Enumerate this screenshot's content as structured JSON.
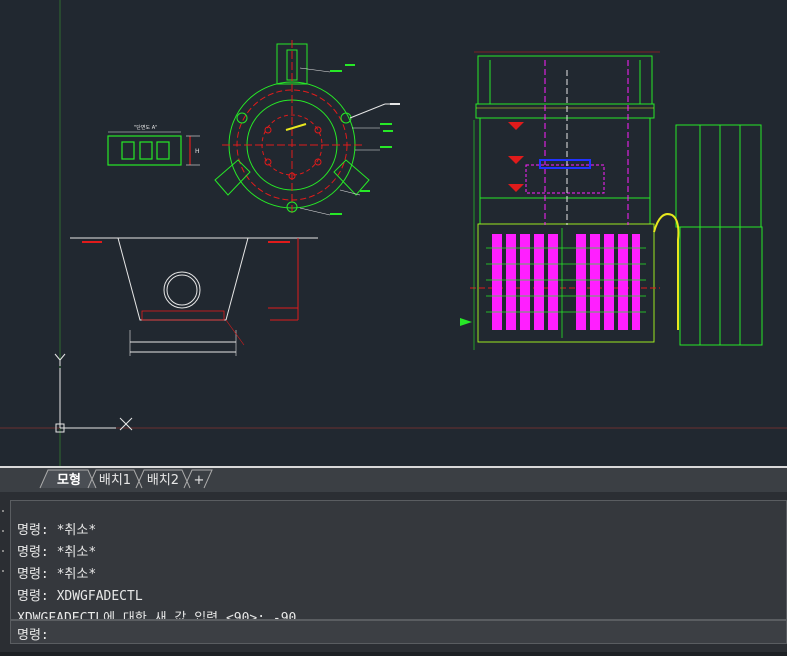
{
  "layout_tabs": [
    {
      "label": "모형",
      "active": true
    },
    {
      "label": "배치1",
      "active": false
    },
    {
      "label": "배치2",
      "active": false
    },
    {
      "label": "+",
      "active": false
    }
  ],
  "command_history": [
    "명령: *취소*",
    "명령: *취소*",
    "명령: *취소*",
    "명령: XDWGFADECTL",
    "XDWGFADECTL에 대한 새 값 입력 <90>: -90"
  ],
  "command_prompt": "명령:",
  "ucs": {
    "x_label": "X",
    "y_label": "Y"
  },
  "drawing_labels": {
    "section_label": "\"단면도 A\"",
    "dim_label": "H"
  },
  "colors": {
    "background": "#212830",
    "green": "#27e827",
    "red": "#e01b1b",
    "magenta": "#ff1fff",
    "white": "#e6e6e6",
    "yellow": "#e8e81e",
    "blue": "#2233ff"
  }
}
